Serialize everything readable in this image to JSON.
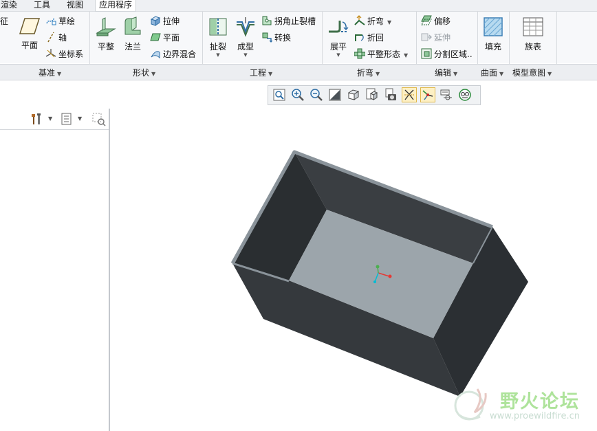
{
  "menu": {
    "tabs": [
      {
        "label": "渲染"
      },
      {
        "label": "工具"
      },
      {
        "label": "视图"
      },
      {
        "label": "应用程序"
      }
    ]
  },
  "ribbon": {
    "datum": {
      "partial_left": "征",
      "plane": "平面",
      "sketch": "草绘",
      "axis": "轴",
      "csys": "坐标系",
      "group_label": "基准"
    },
    "shapes": {
      "flat": "平整",
      "flange": "法兰",
      "extrude": "拉伸",
      "planar": "平面",
      "boundary_blend": "边界混合",
      "group_label": "形状"
    },
    "engineering": {
      "rip": "扯裂",
      "form": "成型",
      "corner_relief": "拐角止裂槽",
      "convert": "转换",
      "group_label": "工程"
    },
    "bends": {
      "unbend": "展平",
      "bend": "折弯",
      "bend_back": "折回",
      "flat_pattern": "平整形态",
      "group_label": "折弯"
    },
    "editing": {
      "offset": "偏移",
      "extend": "延伸",
      "split_area": "分割区域..",
      "group_label": "编辑"
    },
    "surfaces": {
      "fill": "填充",
      "group_label": "曲面"
    },
    "model_intent": {
      "family_table": "族表",
      "group_label": "模型意图"
    }
  },
  "view_toolbar": {
    "buttons": [
      {
        "icon": "refit-icon"
      },
      {
        "icon": "zoom-in-icon"
      },
      {
        "icon": "zoom-out-icon"
      },
      {
        "icon": "repaint-icon"
      },
      {
        "icon": "display-style-icon"
      },
      {
        "icon": "saved-orientations-icon"
      },
      {
        "icon": "view-manager-icon"
      },
      {
        "icon": "datum-display-icon"
      },
      {
        "icon": "spin-center-icon"
      },
      {
        "icon": "annotation-display-icon"
      },
      {
        "icon": "appearance-icon"
      }
    ]
  },
  "watermark": {
    "title": "野火论坛",
    "url": "www.proewildfire.cn"
  },
  "colors": {
    "model_dark": "#2f3337",
    "model_floor": "#9ca5ab",
    "rim": "#8a939a",
    "csys_x": "#e53935",
    "csys_y": "#4caf50",
    "csys_z": "#00bcd4"
  }
}
